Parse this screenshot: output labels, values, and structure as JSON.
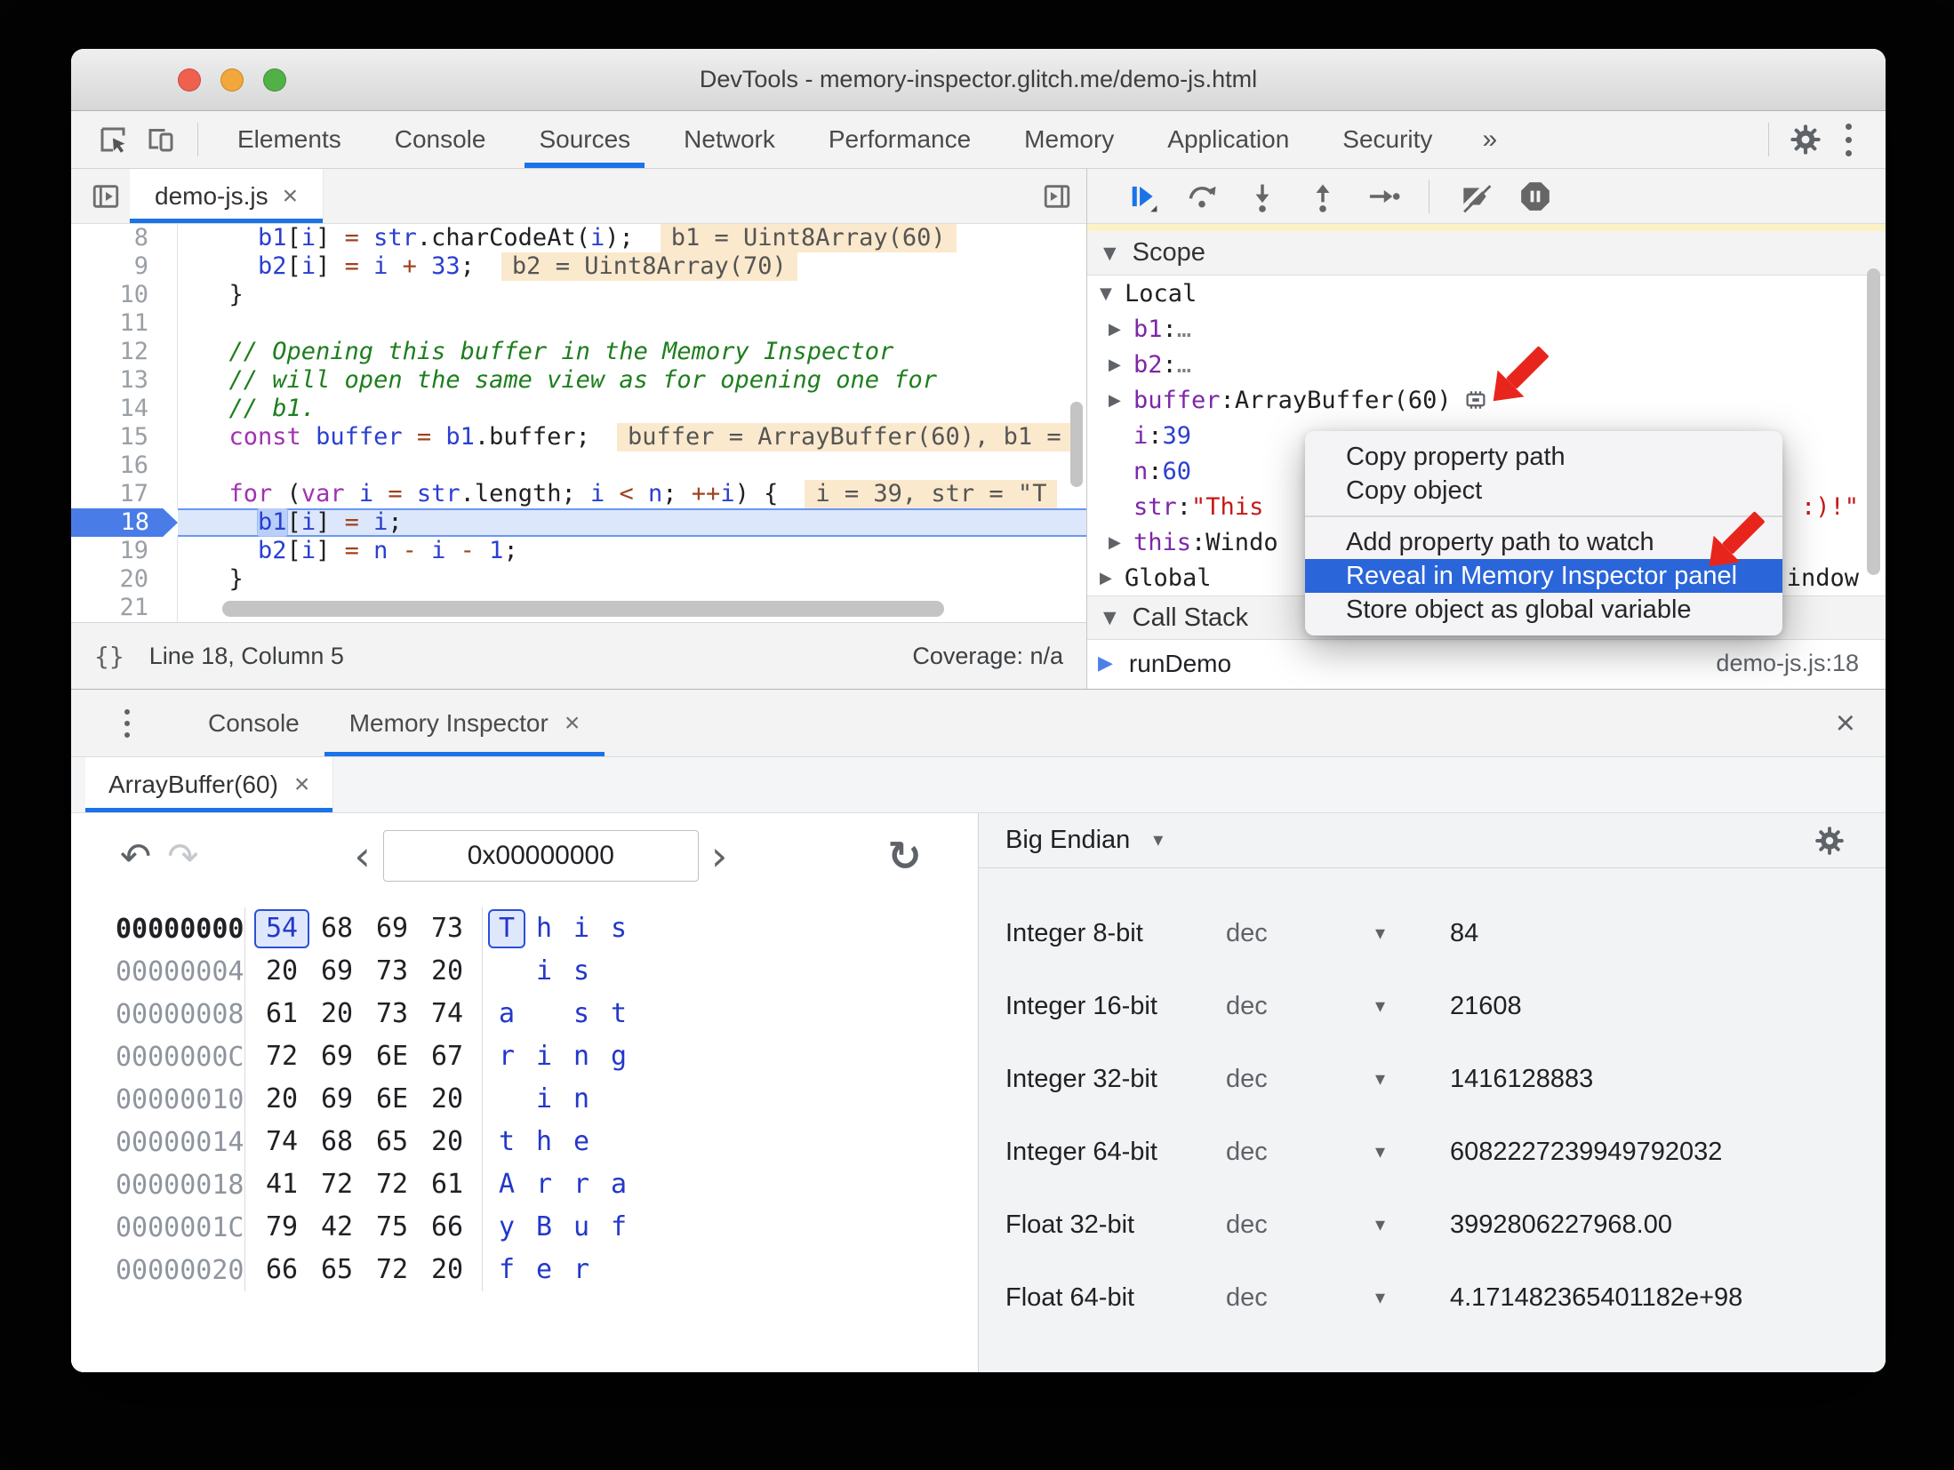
{
  "window": {
    "title": "DevTools - memory-inspector.glitch.me/demo-js.html"
  },
  "icons": {
    "close": "×",
    "more_tabs": "»",
    "chevron_left": "‹",
    "chevron_right": "›",
    "caret_down": "▾",
    "tri_down": "▼",
    "tri_right": "▶",
    "braces": "{}",
    "undo": "↶",
    "redo": "↷",
    "refresh": "↻"
  },
  "colors": {
    "accent_blue": "#1a73e8",
    "menu_highlight": "#2a66d9",
    "arrow_red": "#e8251c",
    "paused_yellow": "#fbf3c6",
    "hint_bg": "#fbe9cd"
  },
  "toolbar": {
    "tabs": [
      "Elements",
      "Console",
      "Sources",
      "Network",
      "Performance",
      "Memory",
      "Application",
      "Security"
    ],
    "active_tab": "Sources"
  },
  "sources_panel": {
    "file_tab": "demo-js.js",
    "status": {
      "line_col": "Line 18, Column 5",
      "coverage": "Coverage: n/a"
    },
    "code_lines": [
      {
        "num": 8,
        "tokens": [
          [
            "    ",
            "p"
          ],
          [
            "b1",
            "v"
          ],
          [
            "[",
            "p"
          ],
          [
            "i",
            "v"
          ],
          [
            "] ",
            "p"
          ],
          [
            "= ",
            "o"
          ],
          [
            "str",
            "v"
          ],
          [
            ".charCodeAt(",
            "p"
          ],
          [
            "i",
            "v"
          ],
          [
            ");",
            "p"
          ]
        ],
        "hint": "b1 = Uint8Array(60)"
      },
      {
        "num": 9,
        "tokens": [
          [
            "    ",
            "p"
          ],
          [
            "b2",
            "v"
          ],
          [
            "[",
            "p"
          ],
          [
            "i",
            "v"
          ],
          [
            "] ",
            "p"
          ],
          [
            "= ",
            "o"
          ],
          [
            "i ",
            "v"
          ],
          [
            "+ ",
            "o"
          ],
          [
            "33",
            "n"
          ],
          [
            ";",
            "p"
          ]
        ],
        "hint": "b2 = Uint8Array(70)"
      },
      {
        "num": 10,
        "tokens": [
          [
            "  }",
            "p"
          ]
        ]
      },
      {
        "num": 11,
        "tokens": []
      },
      {
        "num": 12,
        "tokens": [
          [
            "  // Opening this buffer in the Memory Inspector",
            "c"
          ]
        ]
      },
      {
        "num": 13,
        "tokens": [
          [
            "  // will open the same view as for opening one for",
            "c"
          ]
        ]
      },
      {
        "num": 14,
        "tokens": [
          [
            "  // b1.",
            "c"
          ]
        ]
      },
      {
        "num": 15,
        "tokens": [
          [
            "  ",
            "p"
          ],
          [
            "const",
            "k"
          ],
          [
            " ",
            "p"
          ],
          [
            "buffer ",
            "v"
          ],
          [
            "= ",
            "o"
          ],
          [
            "b1",
            "v"
          ],
          [
            ".buffer;",
            "p"
          ]
        ],
        "hint": "buffer = ArrayBuffer(60), b1 ="
      },
      {
        "num": 16,
        "tokens": []
      },
      {
        "num": 17,
        "tokens": [
          [
            "  ",
            "p"
          ],
          [
            "for",
            "k"
          ],
          [
            " (",
            "p"
          ],
          [
            "var",
            "k"
          ],
          [
            " ",
            "p"
          ],
          [
            "i ",
            "v"
          ],
          [
            "= ",
            "o"
          ],
          [
            "str",
            "v"
          ],
          [
            ".length; ",
            "p"
          ],
          [
            "i ",
            "v"
          ],
          [
            "< ",
            "o"
          ],
          [
            "n",
            "v"
          ],
          [
            "; ",
            "p"
          ],
          [
            "++",
            "o"
          ],
          [
            "i",
            "v"
          ],
          [
            ") {",
            "p"
          ]
        ],
        "hint": "i = 39, str = \"T"
      },
      {
        "num": 18,
        "current": true,
        "tokens": [
          [
            "    ",
            "p"
          ],
          [
            "b1",
            "v sel"
          ],
          [
            "[",
            "p"
          ],
          [
            "i",
            "v"
          ],
          [
            "] ",
            "p"
          ],
          [
            "= ",
            "o"
          ],
          [
            "i",
            "v"
          ],
          [
            ";",
            "p"
          ]
        ]
      },
      {
        "num": 19,
        "tokens": [
          [
            "    ",
            "p"
          ],
          [
            "b2",
            "v"
          ],
          [
            "[",
            "p"
          ],
          [
            "i",
            "v"
          ],
          [
            "] ",
            "p"
          ],
          [
            "= ",
            "o"
          ],
          [
            "n ",
            "v"
          ],
          [
            "- ",
            "o"
          ],
          [
            "i ",
            "v"
          ],
          [
            "- ",
            "o"
          ],
          [
            "1",
            "n"
          ],
          [
            ";",
            "p"
          ]
        ]
      },
      {
        "num": 20,
        "tokens": [
          [
            "  }",
            "p"
          ]
        ]
      },
      {
        "num": 21,
        "tokens": [],
        "hscroll": true
      }
    ]
  },
  "debugger_panel": {
    "scope_title": "Scope",
    "local_label": "Local",
    "variables": [
      {
        "arrow": "▶",
        "name": "b1",
        "value": "…",
        "vcls": "dim"
      },
      {
        "arrow": "▶",
        "name": "b2",
        "value": "…",
        "vcls": "dim"
      },
      {
        "arrow": "▶",
        "name": "buffer",
        "value": "ArrayBuffer(60)",
        "vcls": "obj",
        "chip": true
      },
      {
        "arrow": "",
        "name": "i",
        "value": "39",
        "vcls": "num"
      },
      {
        "arrow": "",
        "name": "n",
        "value": "60",
        "vcls": "num"
      },
      {
        "arrow": "",
        "name": "str",
        "value": "\"This",
        "vcls": "str",
        "right": ":)!\"",
        "rcls": "str"
      },
      {
        "arrow": "▶",
        "name": "this",
        "value": "Windo",
        "vcls": "obj"
      }
    ],
    "global_label": "Global",
    "global_right": "indow",
    "call_stack_title": "Call Stack",
    "frames": [
      {
        "name": "runDemo",
        "location": "demo-js.js:18"
      }
    ]
  },
  "context_menu": {
    "items": [
      {
        "label": "Copy property path"
      },
      {
        "label": "Copy object"
      },
      {
        "type": "separator"
      },
      {
        "label": "Add property path to watch"
      },
      {
        "label": "Reveal in Memory Inspector panel",
        "active": true
      },
      {
        "label": "Store object as global variable"
      }
    ]
  },
  "drawer": {
    "tabs": [
      {
        "label": "Console"
      },
      {
        "label": "Memory Inspector",
        "active": true,
        "closable": true
      }
    ]
  },
  "memory_inspector": {
    "buffer_tab": "ArrayBuffer(60)",
    "address_value": "0x00000000",
    "hex_rows": [
      {
        "addr": "00000000",
        "bytes": [
          "54",
          "68",
          "69",
          "73"
        ],
        "ascii": [
          "T",
          "h",
          "i",
          "s"
        ],
        "selected": 0
      },
      {
        "addr": "00000004",
        "bytes": [
          "20",
          "69",
          "73",
          "20"
        ],
        "ascii": [
          " ",
          "i",
          "s",
          " "
        ]
      },
      {
        "addr": "00000008",
        "bytes": [
          "61",
          "20",
          "73",
          "74"
        ],
        "ascii": [
          "a",
          " ",
          "s",
          "t"
        ]
      },
      {
        "addr": "0000000C",
        "bytes": [
          "72",
          "69",
          "6E",
          "67"
        ],
        "ascii": [
          "r",
          "i",
          "n",
          "g"
        ]
      },
      {
        "addr": "00000010",
        "bytes": [
          "20",
          "69",
          "6E",
          "20"
        ],
        "ascii": [
          " ",
          "i",
          "n",
          " "
        ]
      },
      {
        "addr": "00000014",
        "bytes": [
          "74",
          "68",
          "65",
          "20"
        ],
        "ascii": [
          "t",
          "h",
          "e",
          " "
        ]
      },
      {
        "addr": "00000018",
        "bytes": [
          "41",
          "72",
          "72",
          "61"
        ],
        "ascii": [
          "A",
          "r",
          "r",
          "a"
        ]
      },
      {
        "addr": "0000001C",
        "bytes": [
          "79",
          "42",
          "75",
          "66"
        ],
        "ascii": [
          "y",
          "B",
          "u",
          "f"
        ]
      },
      {
        "addr": "00000020",
        "bytes": [
          "66",
          "65",
          "72",
          "20"
        ],
        "ascii": [
          "f",
          "e",
          "r",
          " "
        ]
      }
    ],
    "interpretation": {
      "endianness": "Big Endian",
      "rows": [
        {
          "label": "Integer 8-bit",
          "format": "dec",
          "value": "84"
        },
        {
          "label": "Integer 16-bit",
          "format": "dec",
          "value": "21608"
        },
        {
          "label": "Integer 32-bit",
          "format": "dec",
          "value": "1416128883"
        },
        {
          "label": "Integer 64-bit",
          "format": "dec",
          "value": "6082227239949792032"
        },
        {
          "label": "Float 32-bit",
          "format": "dec",
          "value": "3992806227968.00"
        },
        {
          "label": "Float 64-bit",
          "format": "dec",
          "value": "4.171482365401182e+98"
        }
      ]
    }
  }
}
